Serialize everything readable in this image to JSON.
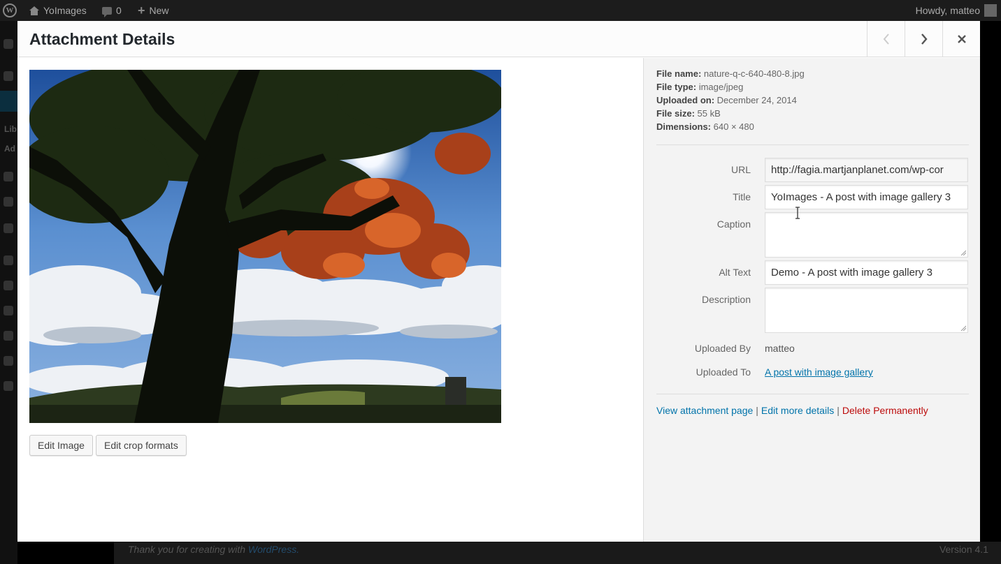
{
  "adminbar": {
    "site_name": "YoImages",
    "comments_count": "0",
    "new_label": "New",
    "greeting": "Howdy, matteo"
  },
  "sidebar": {
    "lib_label": "Lib",
    "add_label": "Ad"
  },
  "footer": {
    "thanks_prefix": "Thank you for creating with",
    "thanks_link": "WordPress.",
    "version": "Version 4.1"
  },
  "modal": {
    "title": "Attachment Details",
    "prev_icon": "chevron-left-icon",
    "next_icon": "chevron-right-icon",
    "close_icon": "close-icon"
  },
  "media": {
    "edit_image_label": "Edit Image",
    "edit_crop_label": "Edit crop formats"
  },
  "details": {
    "file_name_label": "File name:",
    "file_name": "nature-q-c-640-480-8.jpg",
    "file_type_label": "File type:",
    "file_type": "image/jpeg",
    "uploaded_on_label": "Uploaded on:",
    "uploaded_on": "December 24, 2014",
    "file_size_label": "File size:",
    "file_size": "55 kB",
    "dimensions_label": "Dimensions:",
    "dimensions": "640 × 480"
  },
  "fields": {
    "url_label": "URL",
    "url_value": "http://fagia.martjanplanet.com/wp-cor",
    "title_label": "Title",
    "title_value": "YoImages - A post with image gallery 3",
    "caption_label": "Caption",
    "caption_value": "",
    "alt_label": "Alt Text",
    "alt_value": "Demo - A post with image gallery 3",
    "description_label": "Description",
    "description_value": "",
    "uploaded_by_label": "Uploaded By",
    "uploaded_by_value": "matteo",
    "uploaded_to_label": "Uploaded To",
    "uploaded_to_value": "A post with image gallery"
  },
  "actions": {
    "view_label": "View attachment page",
    "edit_label": "Edit more details",
    "delete_label": "Delete Permanently",
    "separator": "|"
  },
  "colors": {
    "link": "#0073aa",
    "danger": "#bc0b0b",
    "adminbar": "#1c1c1c"
  }
}
